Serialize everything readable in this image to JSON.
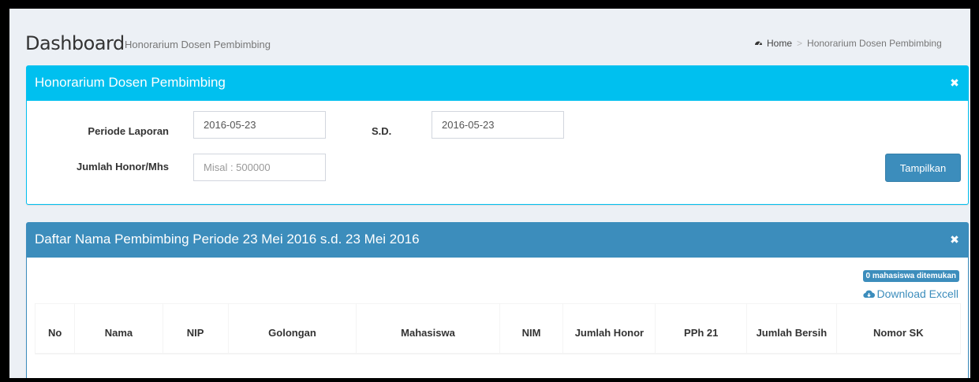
{
  "page": {
    "title": "Dashboard",
    "subtitle": "Honorarium Dosen Pembimbing"
  },
  "breadcrumb": {
    "home_icon": "dashboard-icon",
    "home": "Home",
    "separator": ">",
    "current": "Honorarium Dosen Pembimbing"
  },
  "filter_box": {
    "title": "Honorarium Dosen Pembimbing",
    "close_icon": "close-icon",
    "periode_label": "Periode Laporan",
    "periode_value": "2016-05-23",
    "sd_label": "S.D.",
    "sd_value": "2016-05-23",
    "honor_label": "Jumlah Honor/Mhs",
    "honor_placeholder": "Misal : 500000",
    "submit_label": "Tampilkan"
  },
  "result_box": {
    "title": "Daftar Nama Pembimbing Periode 23 Mei 2016 s.d. 23 Mei 2016",
    "close_icon": "close-icon",
    "count_badge": "0 mahasiswa ditemukan",
    "download_icon": "cloud-download-icon",
    "download_label": "Download Excell",
    "columns": [
      "No",
      "Nama",
      "NIP",
      "Golongan",
      "Mahasiswa",
      "NIM",
      "Jumlah Honor",
      "PPh 21",
      "Jumlah Bersih",
      "Nomor SK"
    ]
  },
  "colors": {
    "info": "#00c0ef",
    "primary": "#3c8dbc",
    "background": "#ecf0f5"
  }
}
